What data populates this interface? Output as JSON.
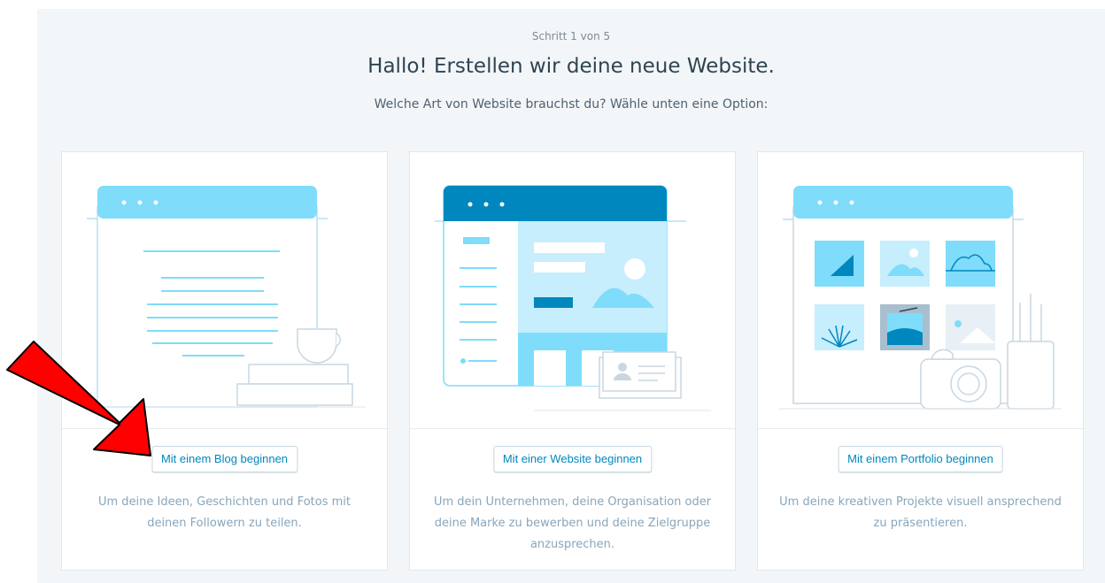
{
  "header": {
    "step": "Schritt 1 von 5",
    "title": "Hallo! Erstellen wir deine neue Website.",
    "subtitle": "Welche Art von Website brauchst du? Wähle unten eine Option:"
  },
  "cards": [
    {
      "button_label": "Mit einem Blog beginnen",
      "description": "Um deine Ideen, Geschichten und Fotos mit deinen Followern zu teilen.",
      "illustration": "blog-illustration"
    },
    {
      "button_label": "Mit einer Website beginnen",
      "description": "Um dein Unternehmen, deine Organisation oder deine Marke zu bewerben und deine Zielgruppe anzusprechen.",
      "illustration": "website-illustration"
    },
    {
      "button_label": "Mit einem Portfolio beginnen",
      "description": "Um deine kreativen Projekte visuell ansprechend zu präsentieren.",
      "illustration": "portfolio-illustration"
    }
  ],
  "annotation": {
    "arrow_color": "#ff0000",
    "icon": "red-arrow-icon"
  },
  "colors": {
    "accent": "#0087be",
    "light_blue": "#7fdcfb",
    "dark_blue": "#0087be"
  }
}
